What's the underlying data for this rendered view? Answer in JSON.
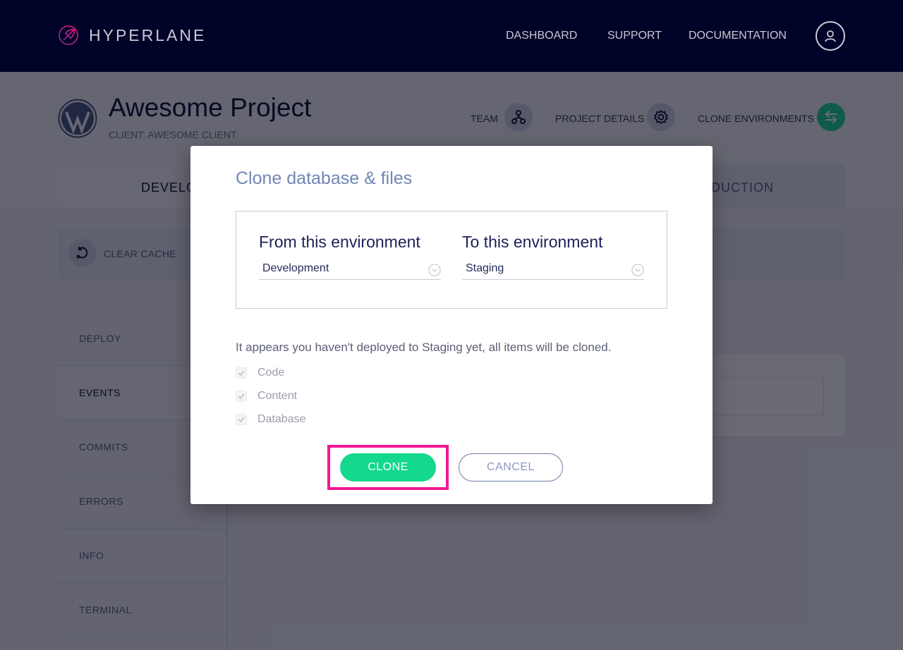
{
  "app": {
    "brand": "HYPERLANE",
    "nav": [
      {
        "label": "DASHBOARD"
      },
      {
        "label": "SUPPORT"
      },
      {
        "label": "DOCUMENTATION"
      }
    ],
    "user_icon": "user-icon"
  },
  "project": {
    "title": "Awesome Project",
    "client": "CLIENT: AWESOME CLIENT",
    "logo_icon": "wordpress-icon",
    "actions": [
      {
        "label": "TEAM",
        "icon": "team-icon"
      },
      {
        "label": "PROJECT DETAILS",
        "icon": "gear-icon"
      },
      {
        "label": "CLONE ENVIRONMENTS",
        "icon": "swap-arrows-icon"
      }
    ]
  },
  "environment_tabs": [
    {
      "label": "DEVELOPMENT",
      "visible_text": "DEVELO",
      "active": true
    },
    {
      "label": "PRODUCTION",
      "visible_text": "UCTION",
      "active": false
    }
  ],
  "toolbar": {
    "clear_cache_label": "CLEAR CACHE"
  },
  "sidebar": {
    "items": [
      {
        "label": "DEPLOY",
        "active": false
      },
      {
        "label": "EVENTS",
        "active": true
      },
      {
        "label": "COMMITS",
        "active": false
      },
      {
        "label": "ERRORS",
        "active": false
      },
      {
        "label": "INFO",
        "active": false
      },
      {
        "label": "TERMINAL",
        "active": false
      }
    ]
  },
  "modal": {
    "title": "Clone database & files",
    "from": {
      "label": "From this environment",
      "value": "Development"
    },
    "to": {
      "label": "To this environment",
      "value": "Staging"
    },
    "notice": "It appears you haven't deployed to Staging yet, all items will be cloned.",
    "items": [
      {
        "label": "Code",
        "checked": true,
        "disabled": true
      },
      {
        "label": "Content",
        "checked": true,
        "disabled": true
      },
      {
        "label": "Database",
        "checked": true,
        "disabled": true
      }
    ],
    "clone_label": "CLONE",
    "cancel_label": "CANCEL"
  },
  "colors": {
    "topbar": "#000228",
    "accent_green": "#14d88d",
    "highlight_pink": "#f21894",
    "modal_title": "#7286b4"
  }
}
